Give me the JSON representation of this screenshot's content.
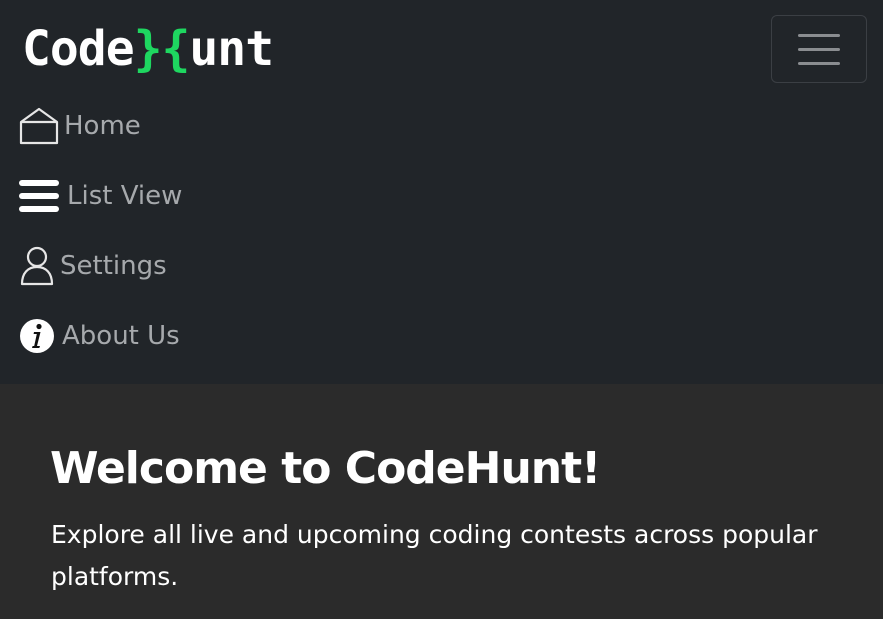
{
  "brand": {
    "part1": "Code",
    "accent": "}{",
    "part2": "unt",
    "accent_color": "#1ed760"
  },
  "navbar": {
    "toggler_icon": "hamburger-icon",
    "items": [
      {
        "label": "Home",
        "icon": "home-icon"
      },
      {
        "label": "List View",
        "icon": "list-icon"
      },
      {
        "label": "Settings",
        "icon": "user-icon"
      },
      {
        "label": "About Us",
        "icon": "info-icon"
      }
    ]
  },
  "hero": {
    "title": "Welcome to CodeHunt!",
    "subtitle": "Explore all live and upcoming coding contests across popular platforms."
  },
  "colors": {
    "navbar_bg": "#212529",
    "page_bg": "#2b2b2b",
    "nav_text": "#a6a9ac"
  }
}
